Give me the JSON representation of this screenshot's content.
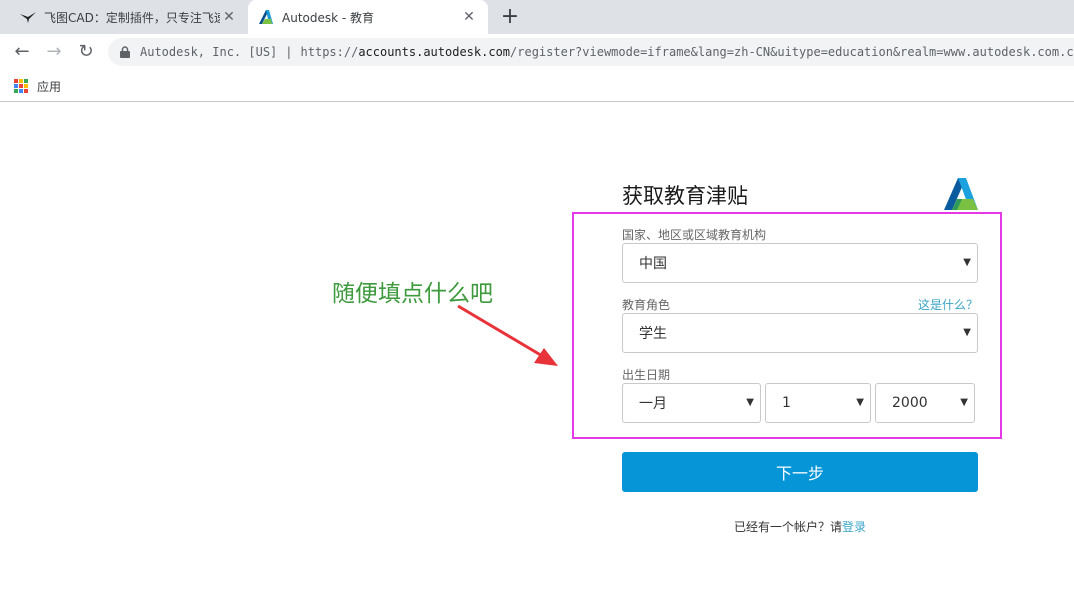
{
  "browser": {
    "tabs": [
      {
        "title": "飞图CAD：定制插件，只专注飞速",
        "icon": "bird-favicon-icon",
        "active": false
      },
      {
        "title": "Autodesk - 教育",
        "icon": "autodesk-favicon-icon",
        "active": true
      }
    ],
    "close_glyph": "✕",
    "new_tab_glyph": "+",
    "nav": {
      "back": "←",
      "forward": "→",
      "reload": "↻"
    },
    "address": {
      "org": "Autodesk, Inc. [US]",
      "separator": "|",
      "scheme": "https://",
      "host": "accounts.autodesk.com",
      "path": "/register?viewmode=iframe&lang=zh-CN&uitype=education&realm=www.autodesk.com.cn&ctx"
    },
    "bookmarks": {
      "apps_label": "应用"
    }
  },
  "form": {
    "title": "获取教育津贴",
    "country": {
      "label": "国家、地区或区域教育机构",
      "value": "中国"
    },
    "role": {
      "label": "教育角色",
      "help_link": "这是什么？",
      "value": "学生"
    },
    "birthdate": {
      "label": "出生日期",
      "month": "一月",
      "day": "1",
      "year": "2000"
    },
    "dropdown_glyph": "▼",
    "next_button": "下一步",
    "login_prompt": "已经有一个帐户？请",
    "login_link": "登录"
  },
  "annotation": {
    "text": "随便填点什么吧",
    "text_color": "#3d9a3d",
    "arrow_color": "#e8333a",
    "box_color": "#e639e6"
  },
  "colors": {
    "primary_button": "#0696d7",
    "link": "#3aa4c7"
  }
}
